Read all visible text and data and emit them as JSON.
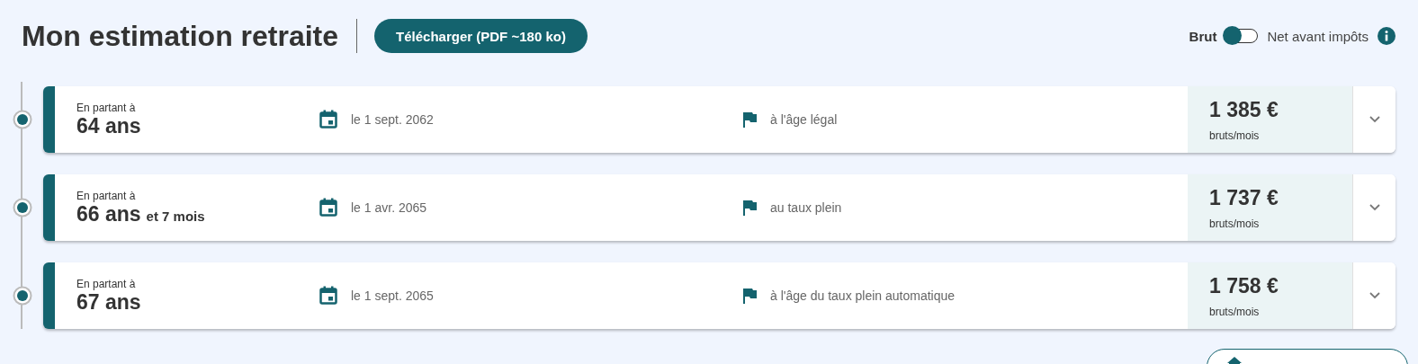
{
  "header": {
    "title": "Mon estimation retraite",
    "download_button": "Télécharger (PDF ~180 ko)"
  },
  "toggle": {
    "left_label": "Brut",
    "right_label": "Net avant impôts",
    "on": false
  },
  "scenarios": [
    {
      "caption": "En partant à",
      "age": "64 ans",
      "date": "le 1 sept. 2062",
      "condition": "à l'âge légal",
      "amount": "1 385 €",
      "unit": "bruts/mois",
      "expanded": false
    },
    {
      "caption": "En partant à",
      "age": "66 ans",
      "extra": "et 7 mois",
      "date": "le 1 avr. 2065",
      "condition": "au taux plein",
      "amount": "1 737 €",
      "unit": "bruts/mois",
      "expanded": false
    },
    {
      "caption": "En partant à",
      "age": "67 ans",
      "date": "le 1 sept. 2065",
      "condition": "à l'âge du taux plein automatique",
      "amount": "1 758 €",
      "unit": "bruts/mois",
      "expanded": false
    }
  ]
}
